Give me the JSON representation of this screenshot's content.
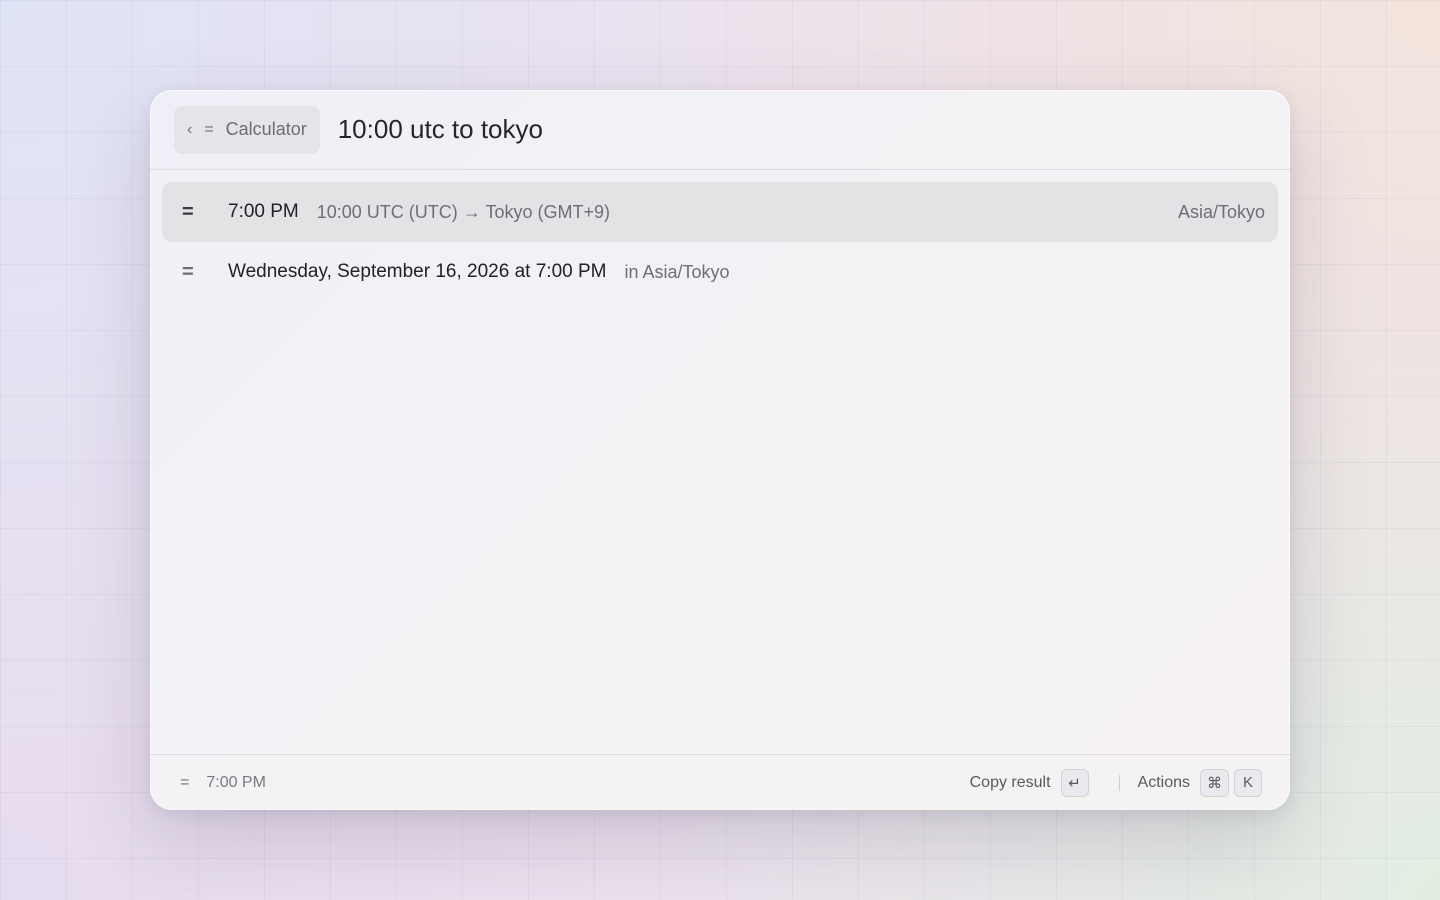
{
  "header": {
    "back_icon": "‹",
    "extension_icon": "=",
    "extension_name": "Calculator",
    "query": "10:00 utc to tokyo"
  },
  "results": [
    {
      "icon": "=",
      "title": "7:00 PM",
      "subtitle": "10:00 UTC (UTC) → Tokyo (GMT+9)",
      "accessory": "Asia/Tokyo",
      "selected": true
    },
    {
      "icon": "=",
      "title": "Wednesday, September 16, 2026 at 7:00 PM",
      "subtitle": "in Asia/Tokyo",
      "accessory": "",
      "selected": false
    }
  ],
  "footer": {
    "icon": "=",
    "value": "7:00 PM",
    "primary_action": "Copy result",
    "primary_key": "↵",
    "actions_label": "Actions",
    "actions_keys": [
      "⌘",
      "K"
    ]
  }
}
